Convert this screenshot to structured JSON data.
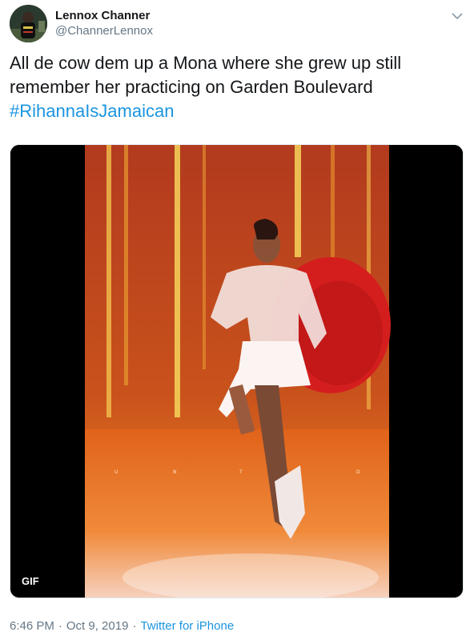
{
  "author": {
    "display_name": "Lennox Channer",
    "handle": "@ChannerLennox",
    "avatar_icon": "profile-photo"
  },
  "menu_icon": "chevron-down-icon",
  "tweet": {
    "text_line1": "All de cow dem up a Mona where she grew up still",
    "text_line2": "remember her practicing on Garden Boulevard",
    "hashtag": "#RihannaIsJamaican"
  },
  "media": {
    "badge": "GIF",
    "letters": [
      "U",
      "N",
      "T",
      "M",
      "D"
    ]
  },
  "meta": {
    "time": "6:46 PM",
    "separator": "·",
    "date": "Oct 9, 2019",
    "source": "Twitter for iPhone"
  },
  "colors": {
    "link": "#1b95e0",
    "secondary_text": "#657786",
    "primary_text": "#14171a"
  }
}
